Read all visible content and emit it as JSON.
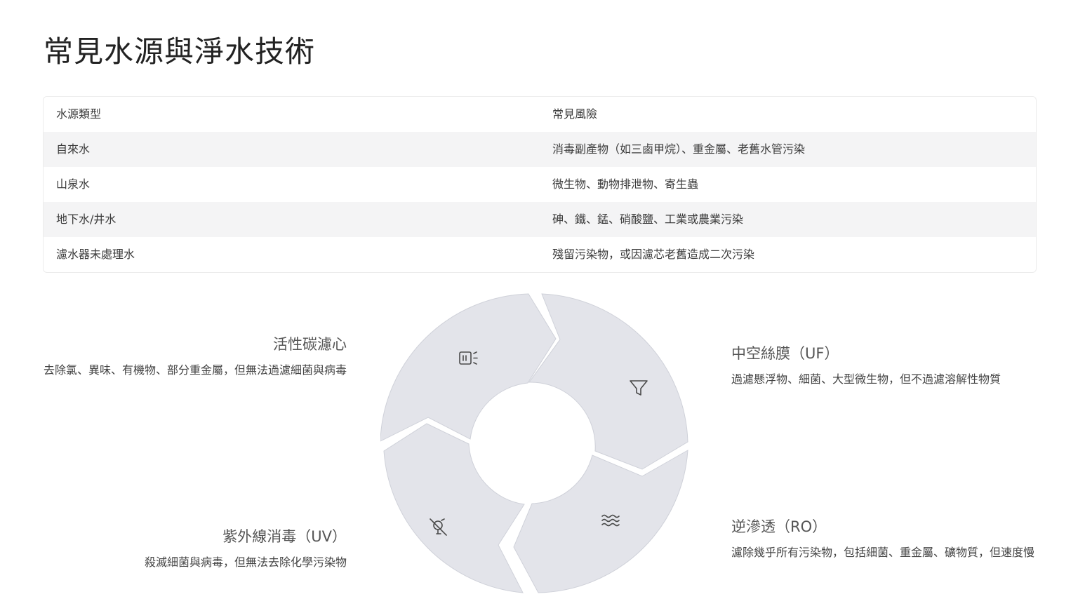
{
  "title": "常見水源與淨水技術",
  "table": {
    "headers": [
      "水源類型",
      "常見風險"
    ],
    "rows": [
      [
        "自來水",
        "消毒副產物（如三鹵甲烷）、重金屬、老舊水管污染"
      ],
      [
        "山泉水",
        "微生物、動物排泄物、寄生蟲"
      ],
      [
        "地下水/井水",
        "砷、鐵、錳、硝酸鹽、工業或農業污染"
      ],
      [
        "濾水器未處理水",
        "殘留污染物，或因濾芯老舊造成二次污染"
      ]
    ]
  },
  "steps": {
    "carbon": {
      "title": "活性碳濾心",
      "desc": "去除氯、異味、有機物、部分重金屬，但無法過濾細菌與病毒",
      "icon": "carbon-filter-icon"
    },
    "uf": {
      "title": "中空絲膜（UF）",
      "desc": "過濾懸浮物、細菌、大型微生物，但不過濾溶解性物質",
      "icon": "funnel-filter-icon"
    },
    "ro": {
      "title": "逆滲透（RO）",
      "desc": "濾除幾乎所有污染物，包括細菌、重金屬、礦物質，但速度慢",
      "icon": "water-waves-icon"
    },
    "uv": {
      "title": "紫外線消毒（UV）",
      "desc": "殺滅細菌與病毒，但無法去除化學污染物",
      "icon": "germ-off-icon"
    }
  },
  "colors": {
    "segment_fill": "#e3e4ea",
    "row_shade": "#f4f4f5",
    "title_text": "#222222"
  }
}
